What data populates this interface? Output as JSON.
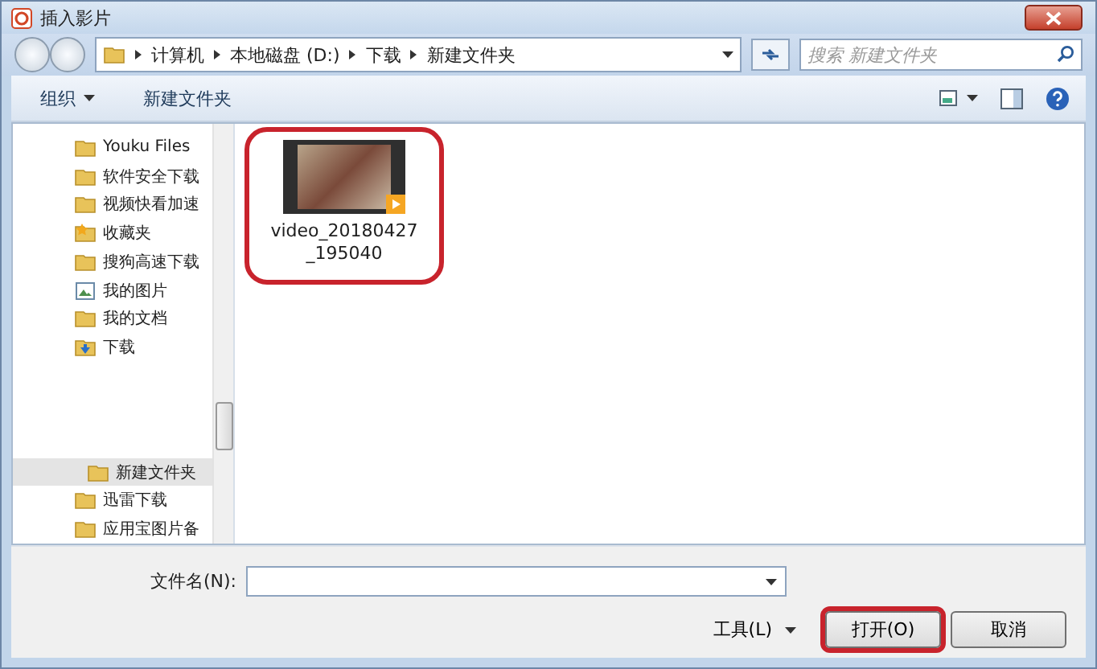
{
  "window": {
    "title": "插入影片"
  },
  "address": {
    "path": [
      "计算机",
      "本地磁盘 (D:)",
      "下载",
      "新建文件夹"
    ],
    "search_placeholder": "搜索 新建文件夹"
  },
  "toolbar": {
    "organize": "组织",
    "new_folder": "新建文件夹"
  },
  "sidebar": {
    "items": [
      {
        "label": "Youku Files",
        "kind": "folder",
        "selected": false
      },
      {
        "label": "软件安全下载",
        "kind": "folder",
        "selected": false
      },
      {
        "label": "视频快看加速",
        "kind": "folder",
        "selected": false
      },
      {
        "label": "收藏夹",
        "kind": "favorites",
        "selected": false
      },
      {
        "label": "搜狗高速下载",
        "kind": "folder",
        "selected": false
      },
      {
        "label": "我的图片",
        "kind": "pictures",
        "selected": false
      },
      {
        "label": "我的文档",
        "kind": "folder",
        "selected": false
      },
      {
        "label": "下载",
        "kind": "download",
        "selected": false,
        "children": [
          {
            "label": "新建文件夹",
            "kind": "folder",
            "selected": true
          }
        ]
      },
      {
        "label": "迅雷下载",
        "kind": "folder",
        "selected": false
      },
      {
        "label": "应用宝图片备",
        "kind": "folder",
        "selected": false
      }
    ]
  },
  "files": [
    {
      "name_lines": [
        "video_20180427",
        "_195040"
      ],
      "kind": "video",
      "circled": true
    }
  ],
  "footer": {
    "filename_label": "文件名(N):",
    "tools": "工具(L)",
    "buttons": [
      {
        "label": "打开(O)",
        "circled": true
      },
      {
        "label": "取消",
        "circled": false
      }
    ]
  }
}
